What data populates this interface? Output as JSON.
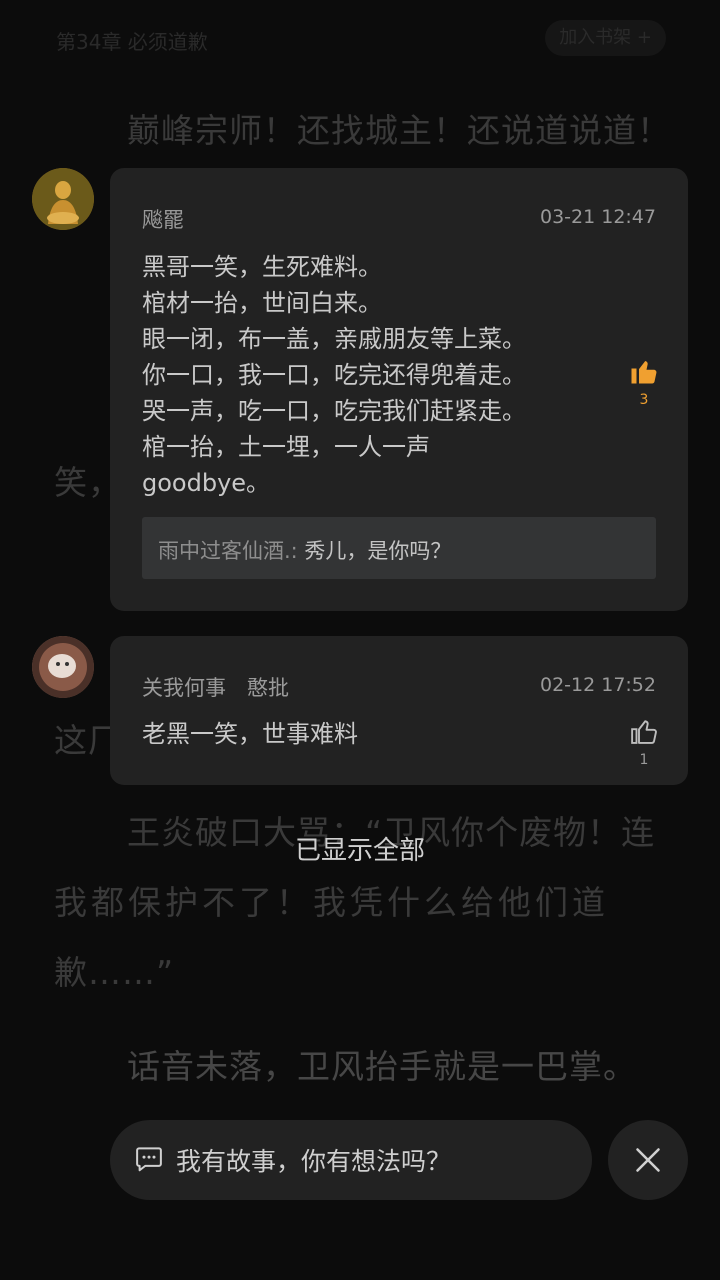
{
  "background": {
    "chapter_title": "第34章 必须道歉",
    "top_button": "加入书架 +",
    "lines": [
      "巅峰宗师！还找城主！还说道说道！",
      "笑，",
      "这厂",
      "王炎破口大骂：“卫风你个废物！连",
      "我都保护不了！我凭什么给他们道",
      "歉……”",
      "话音未落，卫风抬手就是一巴掌。"
    ]
  },
  "comments": [
    {
      "name": "飚罷",
      "time": "03-21 12:47",
      "lines": [
        "黑哥一笑，生死难料。",
        "棺材一抬，世间白来。",
        "眼一闭，布一盖，亲戚朋友等上菜。",
        "你一口，我一口，吃完还得兜着走。",
        "哭一声，吃一口，吃完我们赶紧走。",
        "棺一抬，土一埋，一人一声",
        "goodbye。"
      ],
      "reply_author": "雨中过客仙酒.:",
      "reply_text": " 秀儿，是你吗？",
      "likes": "3",
      "liked": true
    },
    {
      "name": "关我何事　憨批",
      "time": "02-12 17:52",
      "lines": [
        "老黑一笑，世事难料"
      ],
      "likes": "1",
      "liked": false
    }
  ],
  "status": {
    "all_shown": "已显示全部"
  },
  "input": {
    "placeholder": "我有故事，你有想法吗？"
  },
  "colors": {
    "accent_like": "#f0a030",
    "card_bg": "#222222",
    "page_bg": "#0c0c0c"
  }
}
